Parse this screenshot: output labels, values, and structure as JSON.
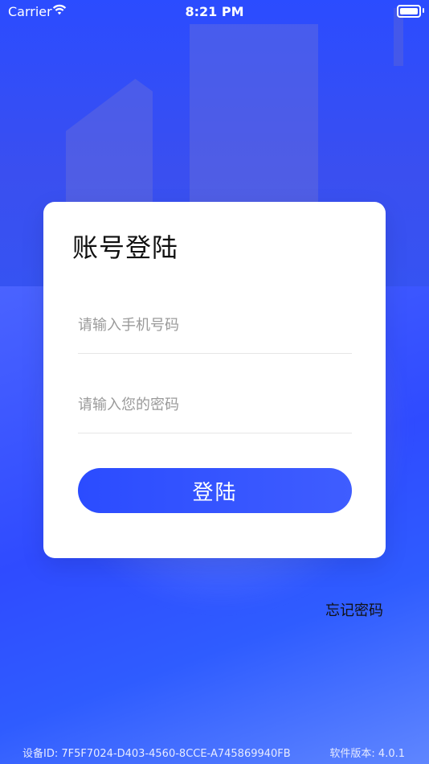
{
  "status_bar": {
    "carrier": "Carrier",
    "time": "8:21 PM",
    "wifi_icon": "wifi-icon",
    "battery_icon": "battery-icon"
  },
  "login_card": {
    "title": "账号登陆",
    "phone_placeholder": "请输入手机号码",
    "password_placeholder": "请输入您的密码",
    "login_button": "登陆"
  },
  "forgot_password": "忘记密码",
  "footer": {
    "device_id": "设备ID: 7F5F7024-D403-4560-8CCE-A745869940FB",
    "version": "软件版本: 4.0.1"
  },
  "colors": {
    "accent": "#2b4cff",
    "card_bg": "#ffffff",
    "button_text": "#ffffff"
  }
}
